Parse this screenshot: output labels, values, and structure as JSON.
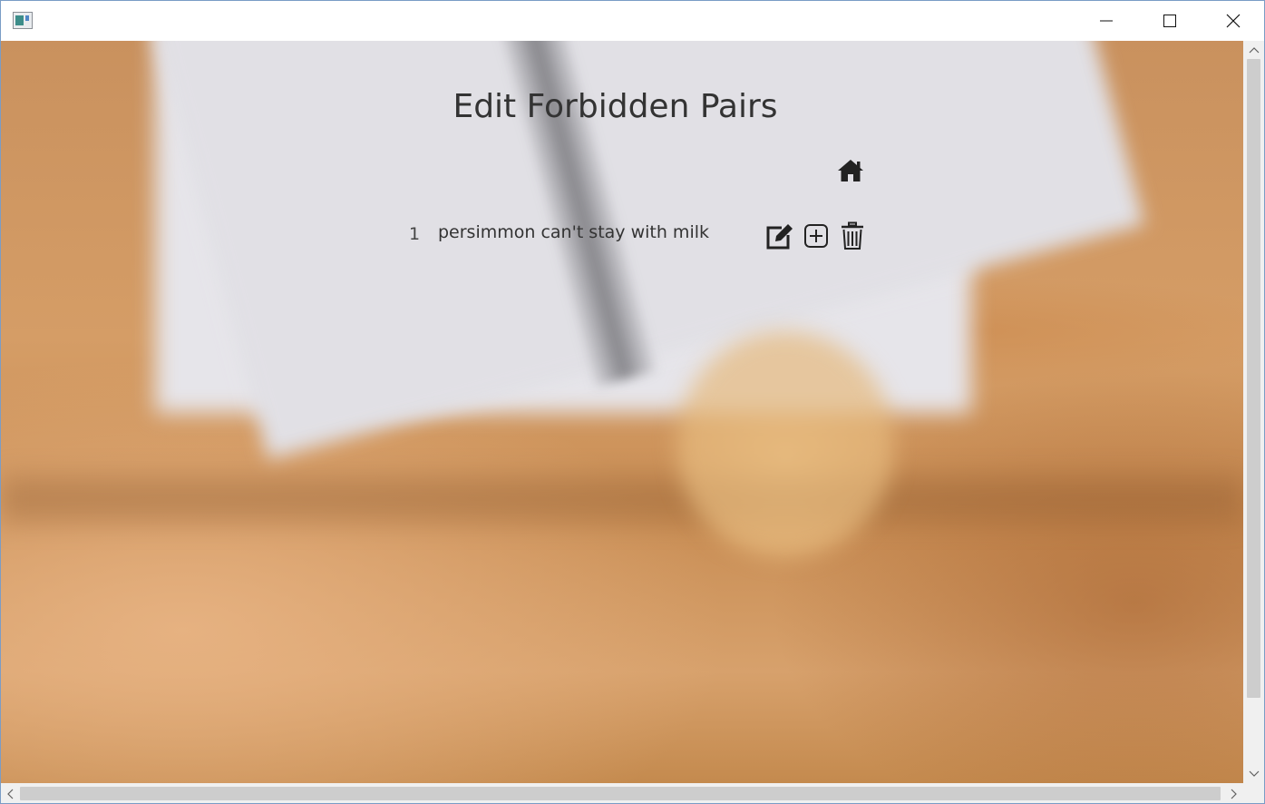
{
  "window": {
    "controls": {
      "minimize_icon": "minimize-icon",
      "maximize_icon": "maximize-icon",
      "close_icon": "close-icon"
    }
  },
  "page": {
    "title": "Edit Forbidden Pairs",
    "home_icon": "home-icon"
  },
  "pairs": [
    {
      "index": "1",
      "text": "persimmon can't stay with milk"
    }
  ],
  "actions": {
    "edit_icon": "edit-icon",
    "add_icon": "add-icon",
    "delete_icon": "trash-icon"
  },
  "colors": {
    "text": "#333333",
    "icon": "#222222",
    "scrollbar_track": "#f0f0f0",
    "scrollbar_thumb": "#cdcdcd"
  }
}
